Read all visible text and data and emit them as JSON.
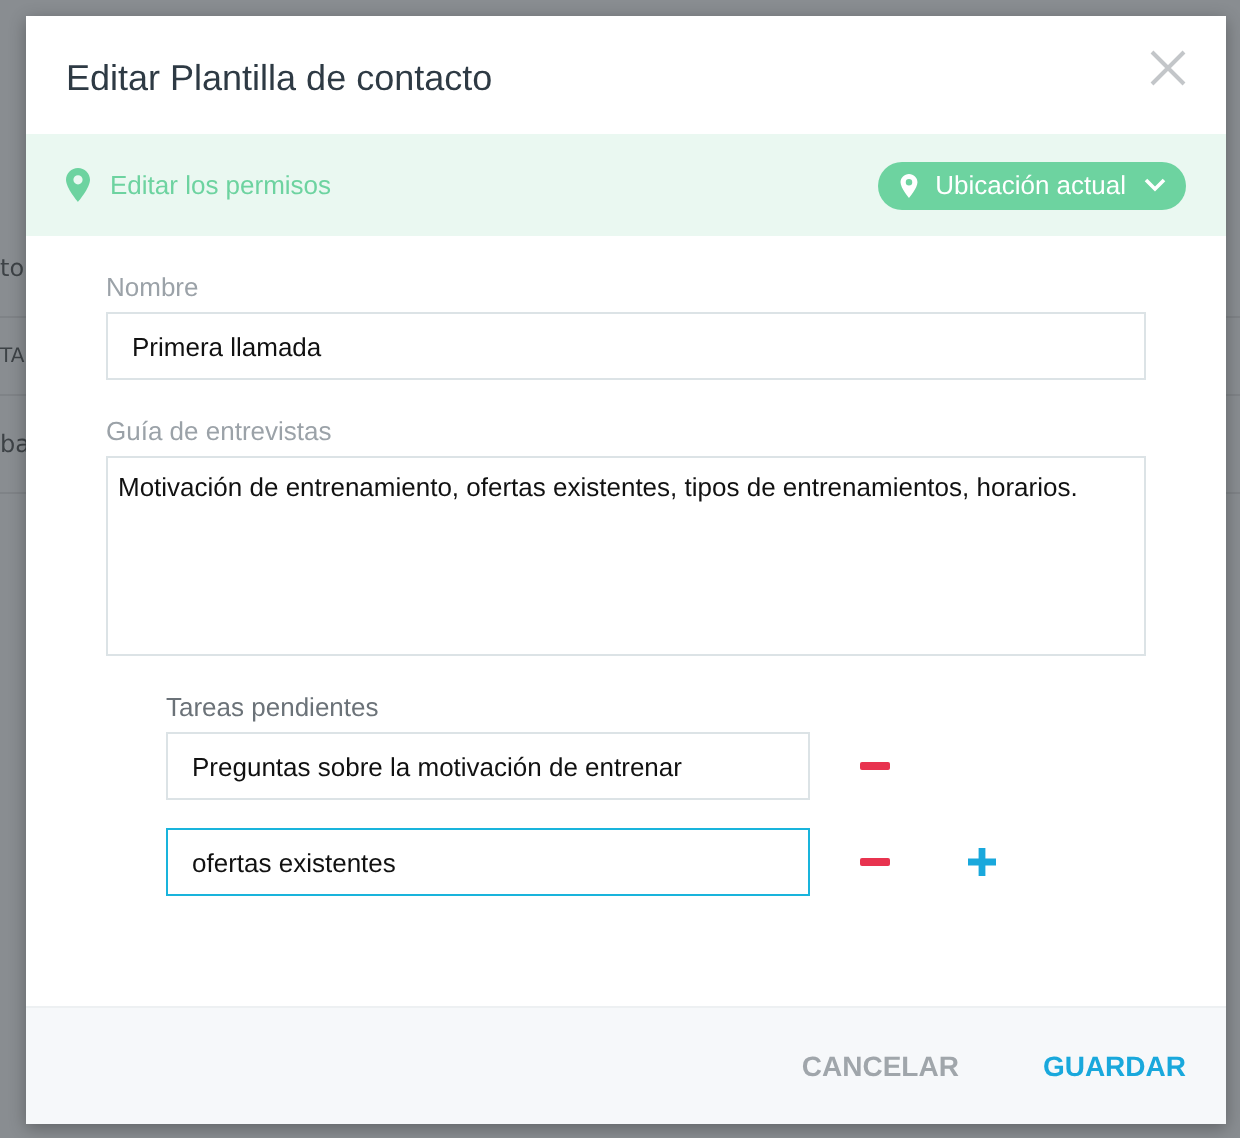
{
  "background": {
    "fragments": [
      "to",
      "TA",
      "ba"
    ]
  },
  "dialog": {
    "title": "Editar Plantilla de contacto",
    "permissions": {
      "label": "Editar los permisos",
      "location": "Ubicación actual"
    },
    "name": {
      "label": "Nombre",
      "value": "Primera llamada"
    },
    "guide": {
      "label": "Guía de entrevistas",
      "value": "Motivación de entrenamiento, ofertas existentes, tipos de entrenamientos, horarios."
    },
    "tasks": {
      "label": "Tareas pendientes",
      "items": [
        {
          "value": "Preguntas sobre la motivación de entrenar",
          "focused": false,
          "can_add": false
        },
        {
          "value": "ofertas existentes",
          "focused": true,
          "can_add": true
        }
      ]
    },
    "buttons": [
      {
        "label": "CANCELAR",
        "kind": "secondary"
      },
      {
        "label": "GUARDAR",
        "kind": "primary"
      }
    ]
  }
}
